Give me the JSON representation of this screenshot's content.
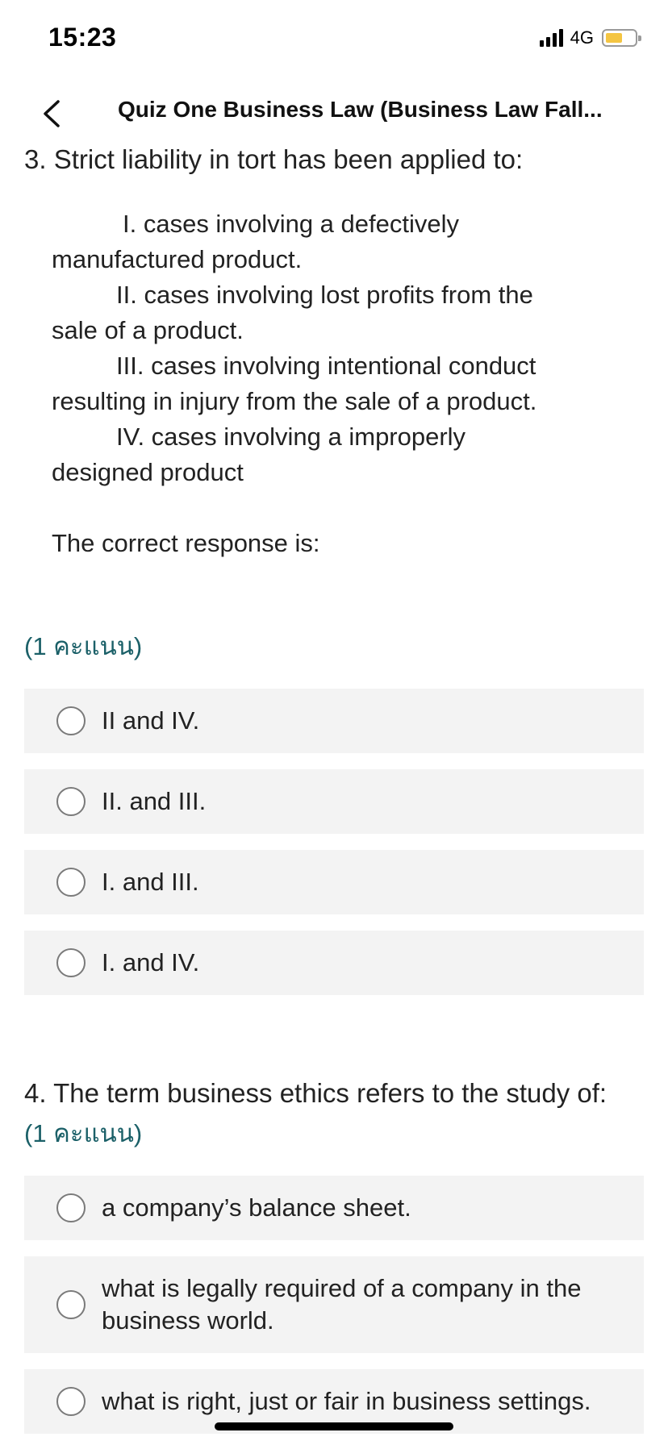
{
  "status": {
    "time": "15:23",
    "network": "4G",
    "battery_color": "#f4c542"
  },
  "header": {
    "title": "Quiz One Business Law  (Business Law Fall..."
  },
  "question3": {
    "title": "3. Strict liability in tort has been applied to:",
    "items": [
      {
        "first": "I.  cases involving a defectively",
        "rest": "manufactured product."
      },
      {
        "first": "II.  cases involving lost profits from the",
        "rest": "sale of a product."
      },
      {
        "first": "III. cases involving intentional conduct",
        "rest": "resulting in injury from the sale of a product."
      },
      {
        "first": "IV. cases involving a improperly",
        "rest": "designed product"
      }
    ],
    "prompt": "The correct response is:",
    "points": "(1 คะแนน)",
    "options": [
      "II and IV.",
      "II. and III.",
      "I. and III.",
      "I. and IV."
    ]
  },
  "question4": {
    "title": "4. The term business ethics refers to the study of:",
    "points": "(1 คะแนน)",
    "options": [
      "a company’s balance sheet.",
      "what is legally required of a company in the business world.",
      "what is right, just or fair in business settings."
    ]
  },
  "colors": {
    "accent": "#1b6068",
    "option_bg": "#f3f3f3"
  }
}
